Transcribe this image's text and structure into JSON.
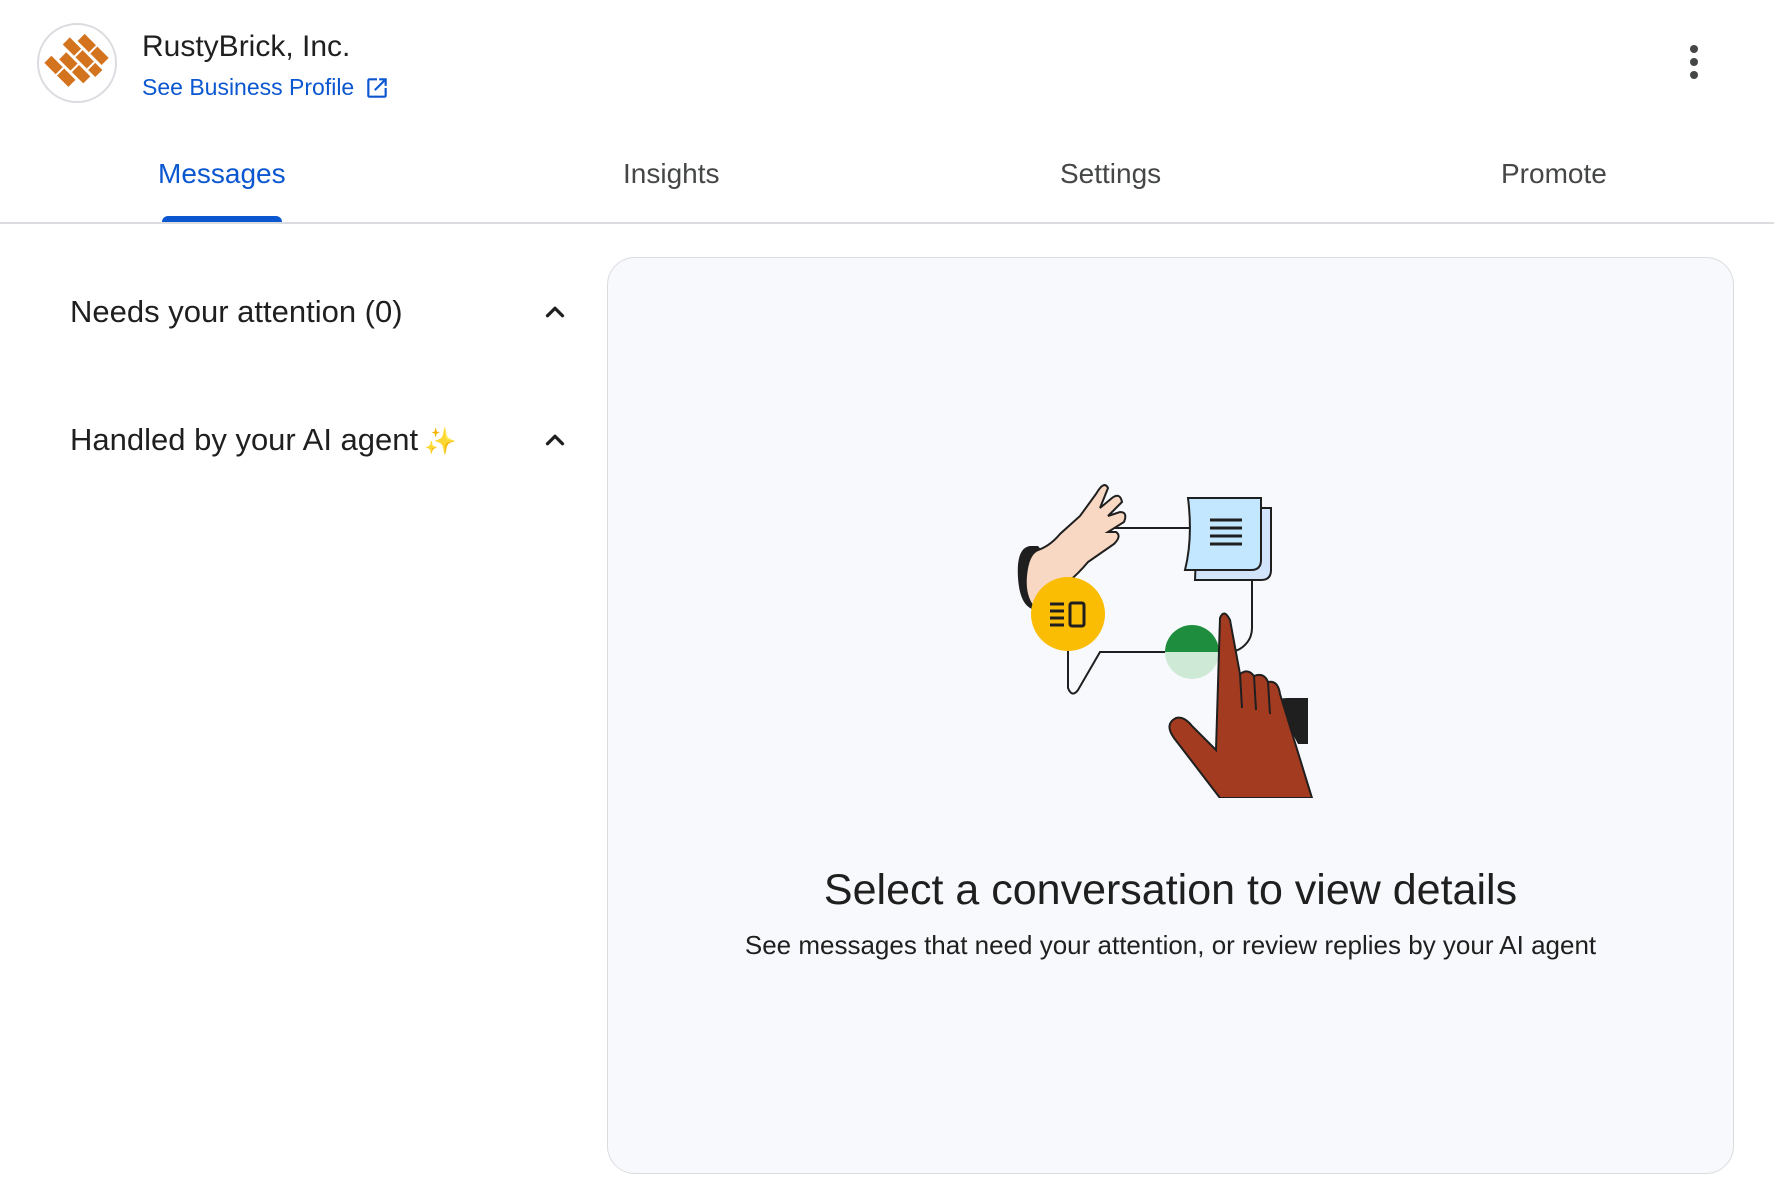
{
  "business": {
    "name": "RustyBrick, Inc.",
    "profile_link": "See Business Profile"
  },
  "tabs": [
    {
      "label": "Messages",
      "active": true
    },
    {
      "label": "Insights",
      "active": false
    },
    {
      "label": "Settings",
      "active": false
    },
    {
      "label": "Promote",
      "active": false
    }
  ],
  "sidebar": {
    "sections": [
      {
        "title": "Needs your attention (0)",
        "expanded": true
      },
      {
        "title": "Handled by your AI agent",
        "icon": "sparkle-icon",
        "expanded": true
      }
    ]
  },
  "empty_state": {
    "title": "Select a conversation to view details",
    "subtitle": "See messages that need your attention, or review replies by your AI agent"
  },
  "colors": {
    "accent": "#0b57d0",
    "logo_orange": "#d4731e",
    "panel_bg": "#f8f9fc"
  }
}
